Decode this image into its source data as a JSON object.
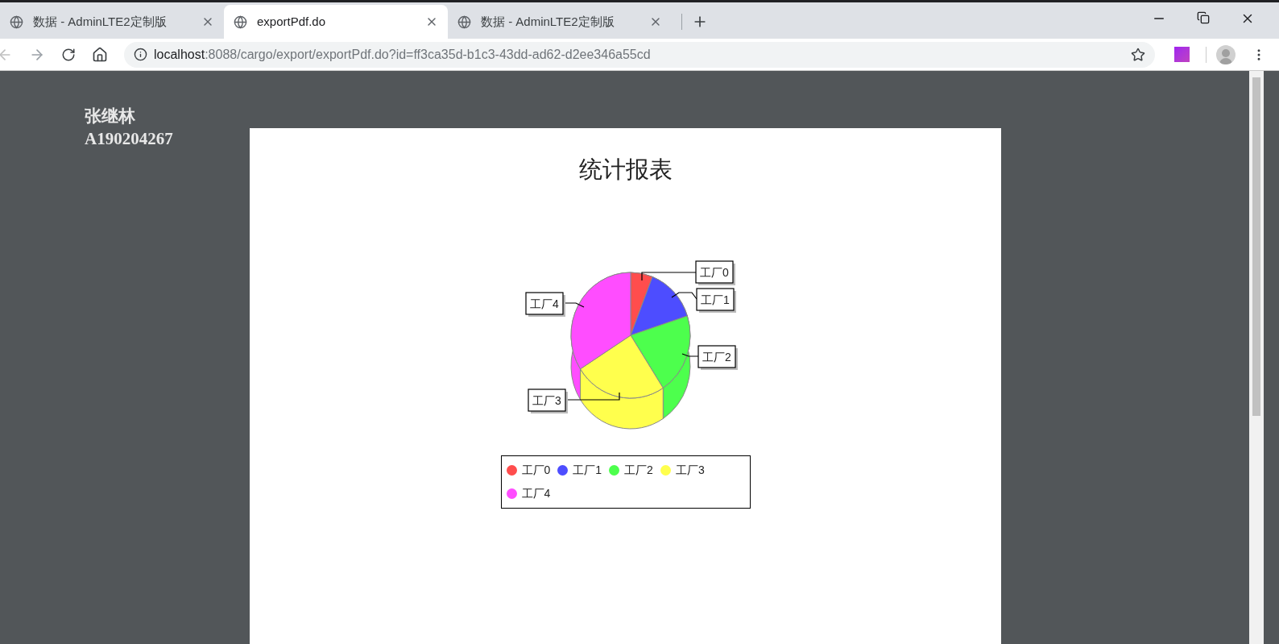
{
  "tabs": [
    {
      "title": "数据 - AdminLTE2定制版",
      "selected": false
    },
    {
      "title": "exportPdf.do",
      "selected": true
    },
    {
      "title": "数据 - AdminLTE2定制版",
      "selected": false
    }
  ],
  "address_bar": {
    "host": "localhost",
    "path": ":8088/cargo/export/exportPdf.do?id=ff3ca35d-b1c3-43dd-ad62-d2ee346a55cd"
  },
  "side_text": [
    "张继林",
    "A190204267"
  ],
  "document": {
    "title": "统计报表",
    "slice_labels": [
      "工厂0",
      "工厂4",
      "工厂1",
      "工厂2",
      "工厂3"
    ],
    "legend": [
      {
        "label": "工厂0",
        "color": "#ff4d4d"
      },
      {
        "label": "工厂1",
        "color": "#4d4dff"
      },
      {
        "label": "工厂2",
        "color": "#4dff4d"
      },
      {
        "label": "工厂3",
        "color": "#ffff4d"
      },
      {
        "label": "工厂4",
        "color": "#ff4dff"
      }
    ]
  }
}
